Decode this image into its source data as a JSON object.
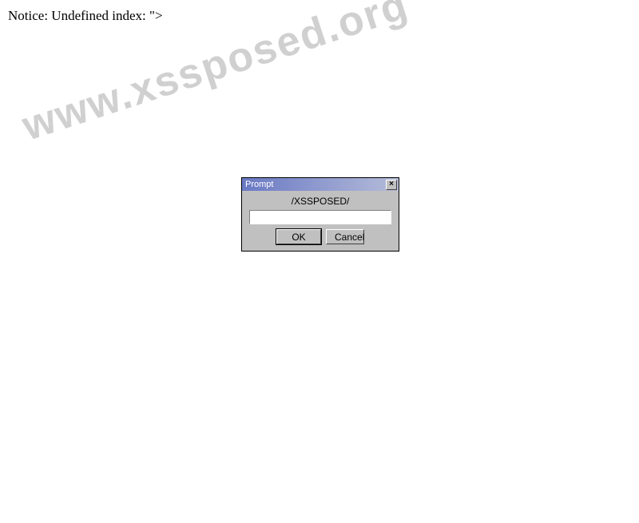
{
  "notice": "Notice: Undefined index: \">",
  "watermark": "www.xssposed.org",
  "dialog": {
    "title": "Prompt",
    "message": "/XSSPOSED/",
    "input_value": "",
    "ok_label": "OK",
    "cancel_label": "Cancel",
    "close_label": "×"
  }
}
